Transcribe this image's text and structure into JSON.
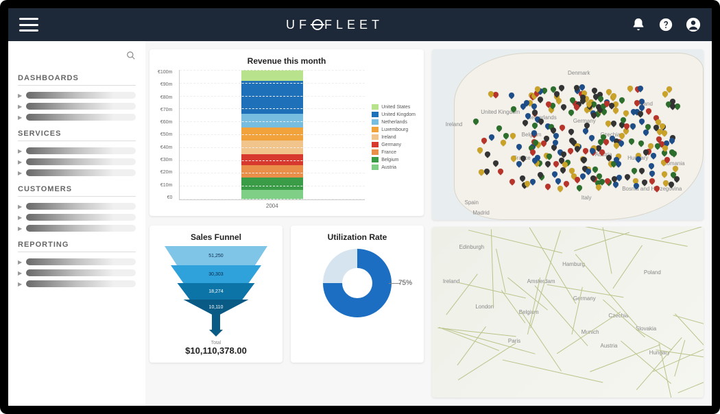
{
  "header": {
    "brand_left": "UF",
    "brand_right": "FLEET",
    "icons": [
      "bell",
      "help",
      "user"
    ]
  },
  "sidebar": {
    "sections": [
      {
        "heading": "DASHBOARDS",
        "item_count": 3
      },
      {
        "heading": "SERVICES",
        "item_count": 3
      },
      {
        "heading": "CUSTOMERS",
        "item_count": 3
      },
      {
        "heading": "REPORTING",
        "item_count": 3
      }
    ]
  },
  "revenue_card": {
    "title": "Revenue this month"
  },
  "chart_data": [
    {
      "type": "bar",
      "title": "Revenue this month",
      "xlabel": "",
      "ylabel": "",
      "ylim": [
        0,
        100
      ],
      "y_ticks": [
        "€100m",
        "€90m",
        "€80m",
        "€70m",
        "€60m",
        "€50m",
        "€40m",
        "€30m",
        "€20m",
        "€10m",
        "€0"
      ],
      "categories": [
        "2004"
      ],
      "series": [
        {
          "name": "United States",
          "values": [
            8
          ],
          "color": "#b9e28c"
        },
        {
          "name": "United Kingdom",
          "values": [
            24
          ],
          "color": "#1e71b8"
        },
        {
          "name": "Netherlands",
          "values": [
            10
          ],
          "color": "#77bde0"
        },
        {
          "name": "Luxembourg",
          "values": [
            9
          ],
          "color": "#f2a23a"
        },
        {
          "name": "Ireland",
          "values": [
            10
          ],
          "color": "#f0c48a"
        },
        {
          "name": "Germany",
          "values": [
            8
          ],
          "color": "#d8392f"
        },
        {
          "name": "France",
          "values": [
            9
          ],
          "color": "#e98f4a"
        },
        {
          "name": "Belgium",
          "values": [
            9
          ],
          "color": "#3b9c47"
        },
        {
          "name": "Austria",
          "values": [
            7
          ],
          "color": "#7fcf87"
        }
      ]
    },
    {
      "type": "funnel",
      "title": "Sales Funnel",
      "stages": [
        {
          "label": "51,250",
          "value": 51250
        },
        {
          "label": "30,303",
          "value": 30303
        },
        {
          "label": "18,274",
          "value": 18274
        },
        {
          "label": "10,110",
          "value": 10110
        }
      ],
      "total_label": "Total",
      "total": "$10,110,378.00"
    },
    {
      "type": "pie",
      "title": "Utilization Rate",
      "value": 75,
      "label": "75%"
    }
  ],
  "maps": {
    "top": {
      "labels": [
        "Denmark",
        "Germany",
        "Poland",
        "France",
        "Italy",
        "Spain",
        "Madrid",
        "Austria",
        "Hungary",
        "Romania",
        "Bosnia and Herzegovina",
        "Ireland",
        "United Kingdom",
        "Netherlands",
        "Belgium",
        "Czechia"
      ]
    },
    "bottom": {
      "labels": [
        "Edinburgh",
        "London",
        "Amsterdam",
        "Paris",
        "Germany",
        "Poland",
        "Czechia",
        "Austria",
        "Slovakia",
        "Hungary",
        "Belgium",
        "Munich",
        "Hamburg",
        "Ireland"
      ]
    }
  }
}
